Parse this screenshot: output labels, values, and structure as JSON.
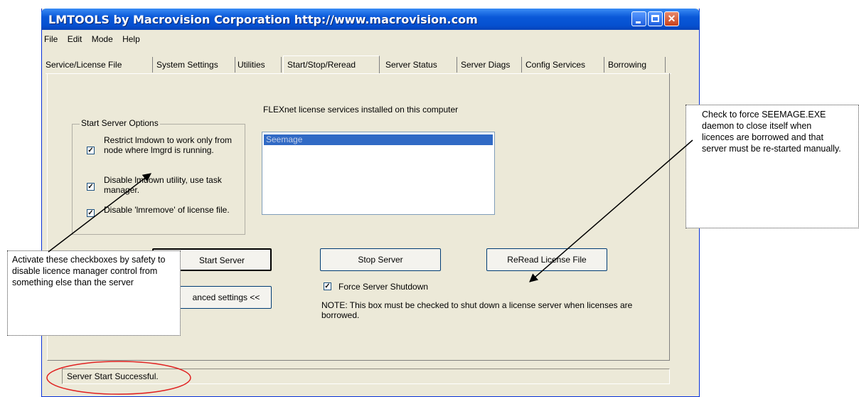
{
  "window": {
    "title": "LMTOOLS by Macrovision Corporation http://www.macrovision.com"
  },
  "menu": [
    "File",
    "Edit",
    "Mode",
    "Help"
  ],
  "tabs": [
    "Service/License File",
    "System Settings",
    "Utilities",
    "Start/Stop/Reread",
    "Server Status",
    "Server Diags",
    "Config Services",
    "Borrowing"
  ],
  "active_tab": "Start/Stop/Reread",
  "start_server_options": {
    "label": "Start Server Options",
    "options": [
      {
        "label": "Restrict lmdown to work only from node where lmgrd is running.",
        "checked": true
      },
      {
        "label": "Disable lmdown utility, use task manager.",
        "checked": true
      },
      {
        "label": "Disable 'lmremove' of license file.",
        "checked": true
      }
    ]
  },
  "services": {
    "label": "FLEXnet license services installed on this computer",
    "items": [
      "Seemage"
    ]
  },
  "buttons": {
    "start_server": "Start Server",
    "stop_server": "Stop Server",
    "reread": "ReRead License File",
    "advanced": "anced settings <<"
  },
  "force_shutdown": {
    "label": "Force Server Shutdown",
    "checked": true
  },
  "note": "NOTE:  This box must be checked to shut down a license server when licenses are borrowed.",
  "status": "Server Start Successful.",
  "callouts": {
    "left": "Activate these checkboxes by safety to disable licence manager control from something else than the server",
    "right": "Check to force SEEMAGE.EXE daemon to close itself when licences are borrowed and that server must be re-started manually."
  },
  "colors": {
    "titlebar": "#0a58d8",
    "window_bg": "#ece9d8",
    "selection": "#316ac5",
    "highlight_ellipse": "#e02020"
  }
}
